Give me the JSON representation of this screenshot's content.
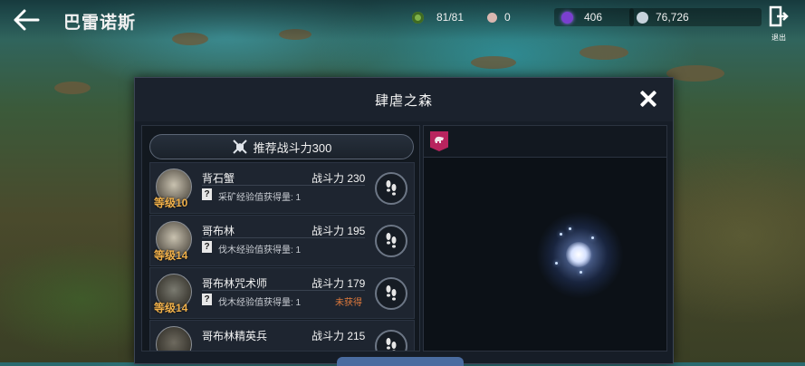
{
  "header": {
    "title": "巴雷诺斯",
    "exit_label": "退出",
    "resources": [
      {
        "icon": "stamina-icon",
        "value": "81/81",
        "color": "#7fb24a"
      },
      {
        "icon": "pearl-icon",
        "value": "0",
        "color": "#d9b7b0"
      },
      {
        "icon": "crystal-icon",
        "value": "406",
        "color": "#7a3fcf"
      },
      {
        "icon": "silver-icon",
        "value": "76,726",
        "color": "#c7d2dc"
      }
    ]
  },
  "dialog": {
    "title": "肆虐之森",
    "recommended_power": "推荐战斗力300",
    "monsters": [
      {
        "name": "背石蟹",
        "power": "战斗力 230",
        "level": "等级10",
        "exp": "采矿经验值获得量: 1",
        "status": ""
      },
      {
        "name": "哥布林",
        "power": "战斗力 195",
        "level": "等级14",
        "exp": "伐木经验值获得量: 1",
        "status": ""
      },
      {
        "name": "哥布林咒术师",
        "power": "战斗力 179",
        "level": "等级14",
        "exp": "伐木经验值获得量: 1",
        "status": "未获得"
      },
      {
        "name": "哥布林精英兵",
        "power": "战斗力 215",
        "level": "",
        "exp": "",
        "status": ""
      }
    ]
  },
  "colors": {
    "accent_badge": "#b8245e",
    "status_orange": "#e07a3c",
    "level_gold": "#f0b04a"
  }
}
